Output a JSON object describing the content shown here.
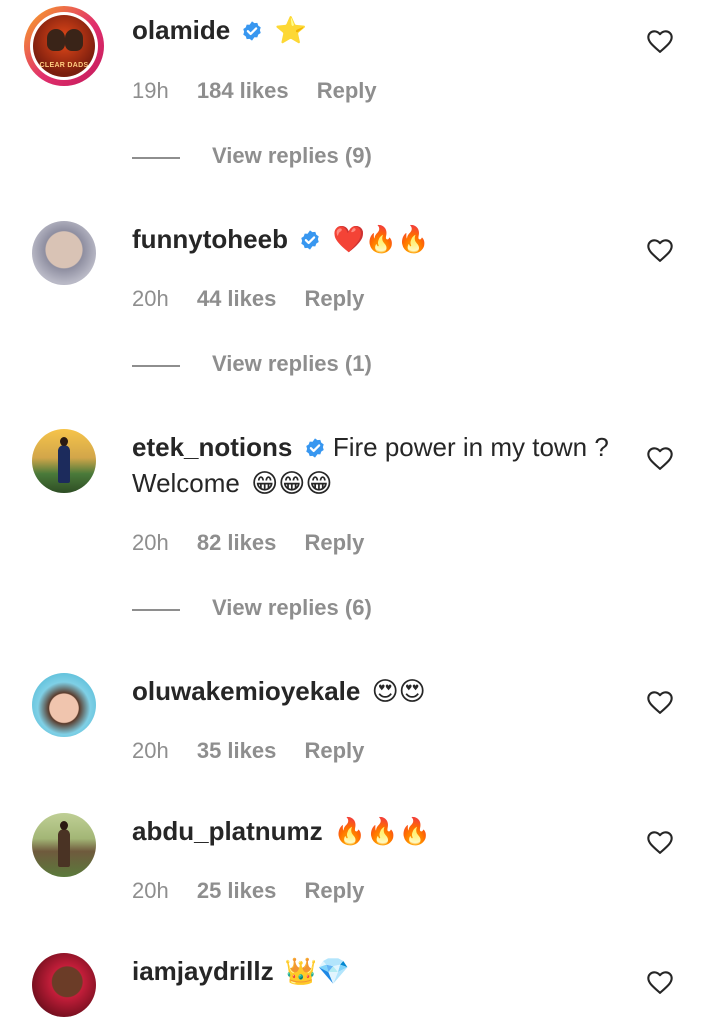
{
  "comments": [
    {
      "username": "olamide",
      "verified": true,
      "text": "",
      "emoji": "⭐",
      "time": "19h",
      "likes": "184 likes",
      "reply": "Reply",
      "view_replies": "View replies (9)",
      "avatar_text": "CLEAR DADS"
    },
    {
      "username": "funnytoheeb",
      "verified": true,
      "text": "",
      "emoji": "❤️🔥🔥",
      "time": "20h",
      "likes": "44 likes",
      "reply": "Reply",
      "view_replies": "View replies (1)"
    },
    {
      "username": "etek_notions",
      "verified": true,
      "text": "Fire power in my town ? Welcome",
      "emoji": "😁😁😁",
      "time": "20h",
      "likes": "82 likes",
      "reply": "Reply",
      "view_replies": "View replies (6)"
    },
    {
      "username": "oluwakemioyekale",
      "verified": false,
      "text": "",
      "emoji": "😍😍",
      "time": "20h",
      "likes": "35 likes",
      "reply": "Reply"
    },
    {
      "username": "abdu_platnumz",
      "verified": false,
      "text": "",
      "emoji": "🔥🔥🔥",
      "time": "20h",
      "likes": "25 likes",
      "reply": "Reply"
    },
    {
      "username": "iamjaydrillz",
      "verified": false,
      "text": "",
      "emoji": "👑💎"
    }
  ],
  "colors": {
    "text": "#262626",
    "muted": "#8e8e8e",
    "verified": "#3897f0"
  },
  "icons": {
    "like": "heart-outline-icon",
    "verified": "verified-badge-icon"
  }
}
